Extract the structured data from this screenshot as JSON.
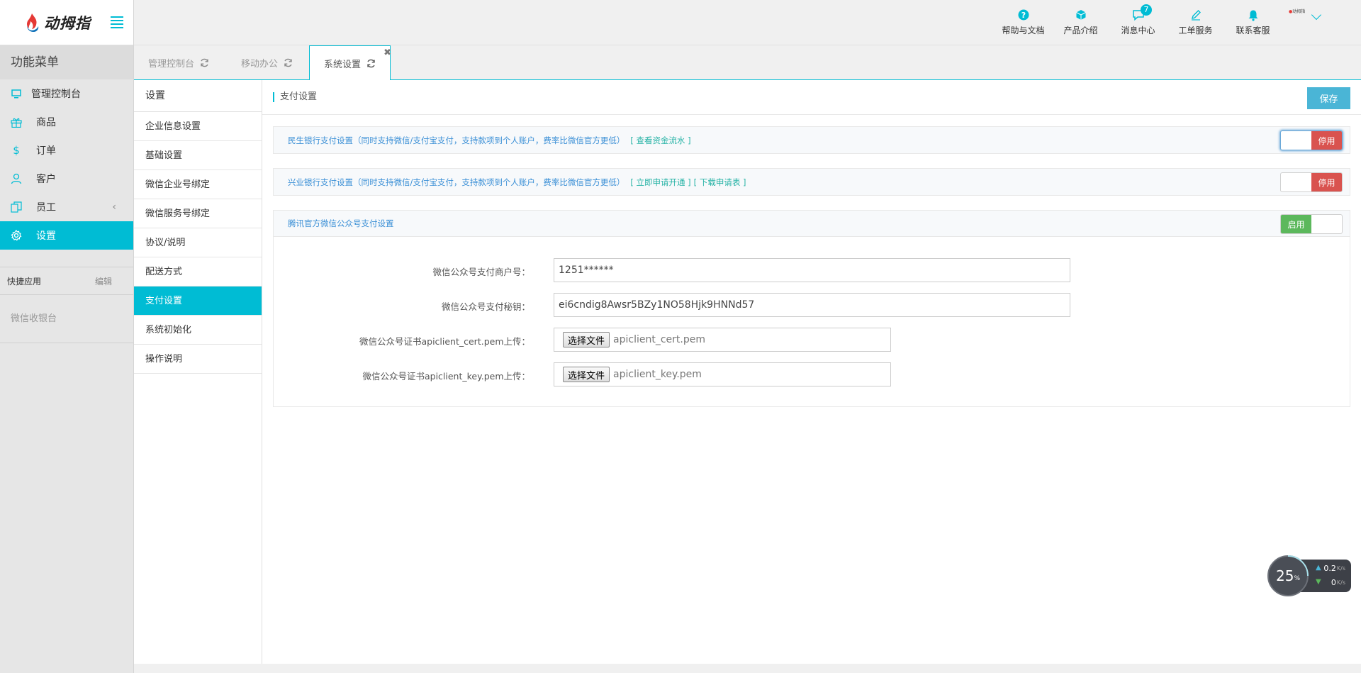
{
  "app": {
    "logo_text": "动拇指"
  },
  "sidebar": {
    "menu_title": "功能菜单",
    "items": [
      {
        "label": "管理控制台",
        "icon": "monitor-icon"
      },
      {
        "label": "商品",
        "icon": "gift-icon"
      },
      {
        "label": "订单",
        "icon": "dollar-icon"
      },
      {
        "label": "客户",
        "icon": "user-icon"
      },
      {
        "label": "员工",
        "icon": "copy-icon"
      },
      {
        "label": "设置",
        "icon": "gear-icon",
        "active": true
      }
    ],
    "quick_apps_label": "快捷应用",
    "edit_label": "编辑",
    "quick_app_item": "微信收银台"
  },
  "header": {
    "nav": [
      {
        "label": "帮助与文档",
        "icon": "help-icon"
      },
      {
        "label": "产品介绍",
        "icon": "cube-icon"
      },
      {
        "label": "消息中心",
        "icon": "message-icon",
        "badge": "7"
      },
      {
        "label": "工单服务",
        "icon": "pencil-icon"
      },
      {
        "label": "联系客服",
        "icon": "bell-icon"
      }
    ],
    "user_avatar_text": "动拇指"
  },
  "tabs": [
    {
      "label": "管理控制台"
    },
    {
      "label": "移动办公"
    },
    {
      "label": "系统设置",
      "active": true
    }
  ],
  "settings_nav": {
    "title": "设置",
    "items": [
      "企业信息设置",
      "基础设置",
      "微信企业号绑定",
      "微信服务号绑定",
      "协议/说明",
      "配送方式",
      "支付设置",
      "系统初始化",
      "操作说明"
    ],
    "active_index": 6
  },
  "content": {
    "title": "支付设置",
    "save_label": "保存",
    "panels": [
      {
        "text": "民生银行支付设置（同时支持微信/支付宝支付，支持款项到个人账户，费率比微信官方更低）",
        "link1": "[ 查看资金流水 ]",
        "toggle_label": "停用",
        "enabled": false
      },
      {
        "text": "兴业银行支付设置（同时支持微信/支付宝支付，支持款项到个人账户，费率比微信官方更低）",
        "link1": "[ 立即申请开通 ]",
        "link2": "[ 下载申请表 ]",
        "toggle_label": "停用",
        "enabled": false
      },
      {
        "text": "腾讯官方微信公众号支付设置",
        "toggle_label": "启用",
        "enabled": true
      }
    ],
    "form": {
      "merchant_label": "微信公众号支付商户号：",
      "merchant_value": "1251******",
      "secret_label": "微信公众号支付秘钥：",
      "secret_value": "ei6cndig8Awsr5BZy1NO58Hjk9HNNd57",
      "cert_label": "微信公众号证书apiclient_cert.pem上传：",
      "cert_button": "选择文件",
      "cert_file": "apiclient_cert.pem",
      "key_label": "微信公众号证书apiclient_key.pem上传：",
      "key_button": "选择文件",
      "key_file": "apiclient_key.pem"
    }
  },
  "speed_widget": {
    "percent": "25",
    "percent_unit": "%",
    "upload": "0.2",
    "download": "0",
    "unit": "K/s"
  },
  "colors": {
    "accent": "#00bcd4",
    "save_button": "#4ab5d6",
    "disabled_red": "#d9534f",
    "enabled_green": "#5cb85c",
    "panel_text_blue": "#3a8fd6",
    "link_teal": "#27b3a6"
  }
}
